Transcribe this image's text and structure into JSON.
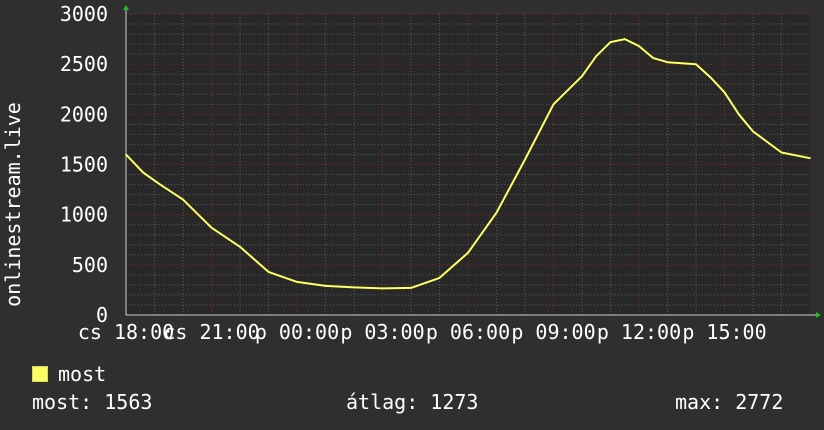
{
  "chart_data": {
    "type": "line",
    "ylabel": "onlinestream.live",
    "ylim": [
      0,
      3000
    ],
    "yticks": [
      0,
      500,
      1000,
      1500,
      2000,
      2500,
      3000
    ],
    "xtick_labels": [
      "cs 18:00",
      "cs 21:00",
      "p 00:00",
      "p 03:00",
      "p 06:00",
      "p 09:00",
      "p 12:00",
      "p 15:00"
    ],
    "x_hours": [
      0,
      0.6,
      1.2,
      2,
      3,
      4,
      5,
      6,
      7,
      8,
      9,
      10,
      11,
      12,
      13,
      14,
      15,
      16,
      16.5,
      17,
      17.5,
      18,
      18.5,
      19,
      20,
      20.5,
      21,
      21.5,
      22,
      23,
      24
    ],
    "series": [
      {
        "name": "most",
        "color": "#ffff66",
        "values": [
          1600,
          1420,
          1300,
          1150,
          870,
          680,
          430,
          330,
          290,
          275,
          265,
          270,
          370,
          620,
          1020,
          1550,
          2100,
          2380,
          2580,
          2720,
          2750,
          2680,
          2560,
          2520,
          2500,
          2370,
          2220,
          2000,
          1830,
          1620,
          1563
        ]
      }
    ],
    "legend": [
      {
        "label": "most",
        "color": "#ffff66"
      }
    ],
    "grid": true,
    "background": "#282828",
    "frame_background": "#2f2f2f",
    "grid_color": "#8a2424"
  },
  "stats": {
    "current": "most: 1563",
    "average": "átlag: 1273",
    "max": "max: 2772"
  }
}
